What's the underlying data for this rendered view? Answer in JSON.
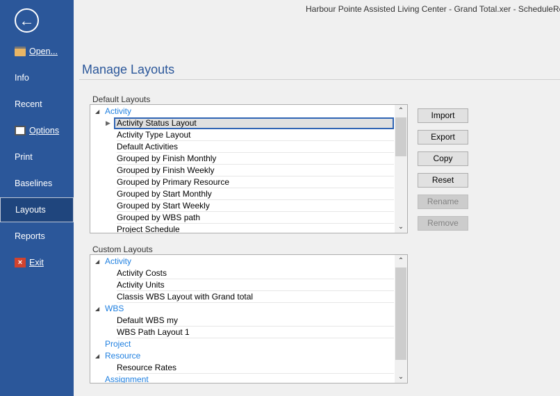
{
  "window": {
    "title": "Harbour Pointe Assisted Living Center - Grand Total.xer - ScheduleReader"
  },
  "sidebar": {
    "items": [
      {
        "label": "Open...",
        "icon": "folder-icon"
      },
      {
        "label": "Info"
      },
      {
        "label": "Recent"
      },
      {
        "label": "Options",
        "icon": "options-icon"
      },
      {
        "label": "Print"
      },
      {
        "label": "Baselines"
      },
      {
        "label": "Layouts",
        "selected": true
      },
      {
        "label": "Reports"
      },
      {
        "label": "Exit",
        "icon": "exit-icon"
      }
    ]
  },
  "main": {
    "heading": "Manage Layouts",
    "default_label": "Default Layouts",
    "custom_label": "Custom Layouts",
    "default_rows": [
      {
        "type": "group",
        "label": "Activity"
      },
      {
        "type": "child",
        "label": "Activity Status Layout",
        "selected": true
      },
      {
        "type": "child",
        "label": "Activity Type Layout"
      },
      {
        "type": "child",
        "label": "Default Activities"
      },
      {
        "type": "child",
        "label": "Grouped by Finish Monthly"
      },
      {
        "type": "child",
        "label": "Grouped by Finish Weekly"
      },
      {
        "type": "child",
        "label": "Grouped by Primary Resource"
      },
      {
        "type": "child",
        "label": "Grouped by Start Monthly"
      },
      {
        "type": "child",
        "label": "Grouped by Start Weekly"
      },
      {
        "type": "child",
        "label": "Grouped by WBS path"
      },
      {
        "type": "child",
        "label": "Project Schedule"
      }
    ],
    "custom_rows": [
      {
        "type": "group",
        "label": "Activity"
      },
      {
        "type": "child",
        "label": "Activity Costs"
      },
      {
        "type": "child",
        "label": "Activity Units"
      },
      {
        "type": "child",
        "label": "Classis WBS Layout with Grand total"
      },
      {
        "type": "group",
        "label": "WBS"
      },
      {
        "type": "child",
        "label": "Default WBS my"
      },
      {
        "type": "child",
        "label": "WBS Path Layout 1"
      },
      {
        "type": "leaf",
        "label": "Project"
      },
      {
        "type": "group",
        "label": "Resource"
      },
      {
        "type": "child",
        "label": "Resource Rates"
      },
      {
        "type": "leaf",
        "label": "Assignment"
      }
    ],
    "buttons": [
      {
        "label": "Import",
        "enabled": true
      },
      {
        "label": "Export",
        "enabled": true
      },
      {
        "label": "Copy",
        "enabled": true
      },
      {
        "label": "Reset",
        "enabled": true
      },
      {
        "label": "Rename",
        "enabled": false
      },
      {
        "label": "Remove",
        "enabled": false
      }
    ]
  },
  "colors": {
    "sidebar": "#2b579a",
    "accent": "#2b579a",
    "group_text": "#1e7fe0"
  }
}
